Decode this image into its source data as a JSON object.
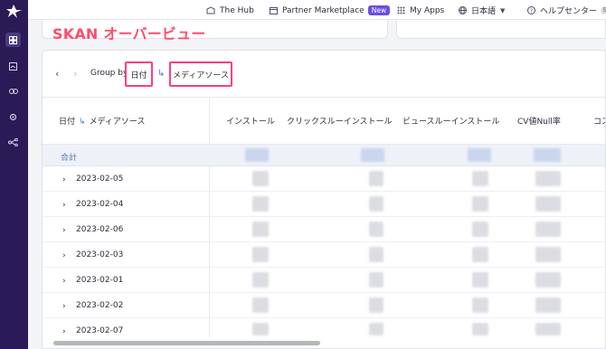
{
  "sidebar": {
    "logo": "company-logo",
    "items": [
      {
        "icon": "dashboard-icon",
        "active": true
      },
      {
        "icon": "report-icon",
        "active": false
      },
      {
        "icon": "link-icon",
        "active": false
      },
      {
        "icon": "gear-icon",
        "active": false
      },
      {
        "icon": "integration-icon",
        "active": false
      }
    ]
  },
  "topbar": {
    "hub": "The Hub",
    "marketplace": "Partner Marketplace",
    "new_badge": "New",
    "myapps": "My Apps",
    "language": "日本語",
    "help": "ヘルプセンター",
    "help_badge": "5"
  },
  "page": {
    "title": "SKAN オーバービュー"
  },
  "groupby": {
    "label": "Group by",
    "first": "日付",
    "second": "メディアソース",
    "highlight_color": "#ff3d7f"
  },
  "table": {
    "dimension_header_a": "日付",
    "dimension_header_b": "メディアソース",
    "columns": [
      "インストール",
      "クリックスルーインストール",
      "ビュースルーインストール",
      "CV値Null率",
      "コス"
    ],
    "total_label": "合計",
    "rows": [
      "2023-02-05",
      "2023-02-04",
      "2023-02-06",
      "2023-02-03",
      "2023-02-01",
      "2023-02-02",
      "2023-02-07"
    ]
  },
  "colors": {
    "sidebar": "#2a1a55",
    "accent": "#6b4ee6",
    "title": "#ff4d6d"
  }
}
